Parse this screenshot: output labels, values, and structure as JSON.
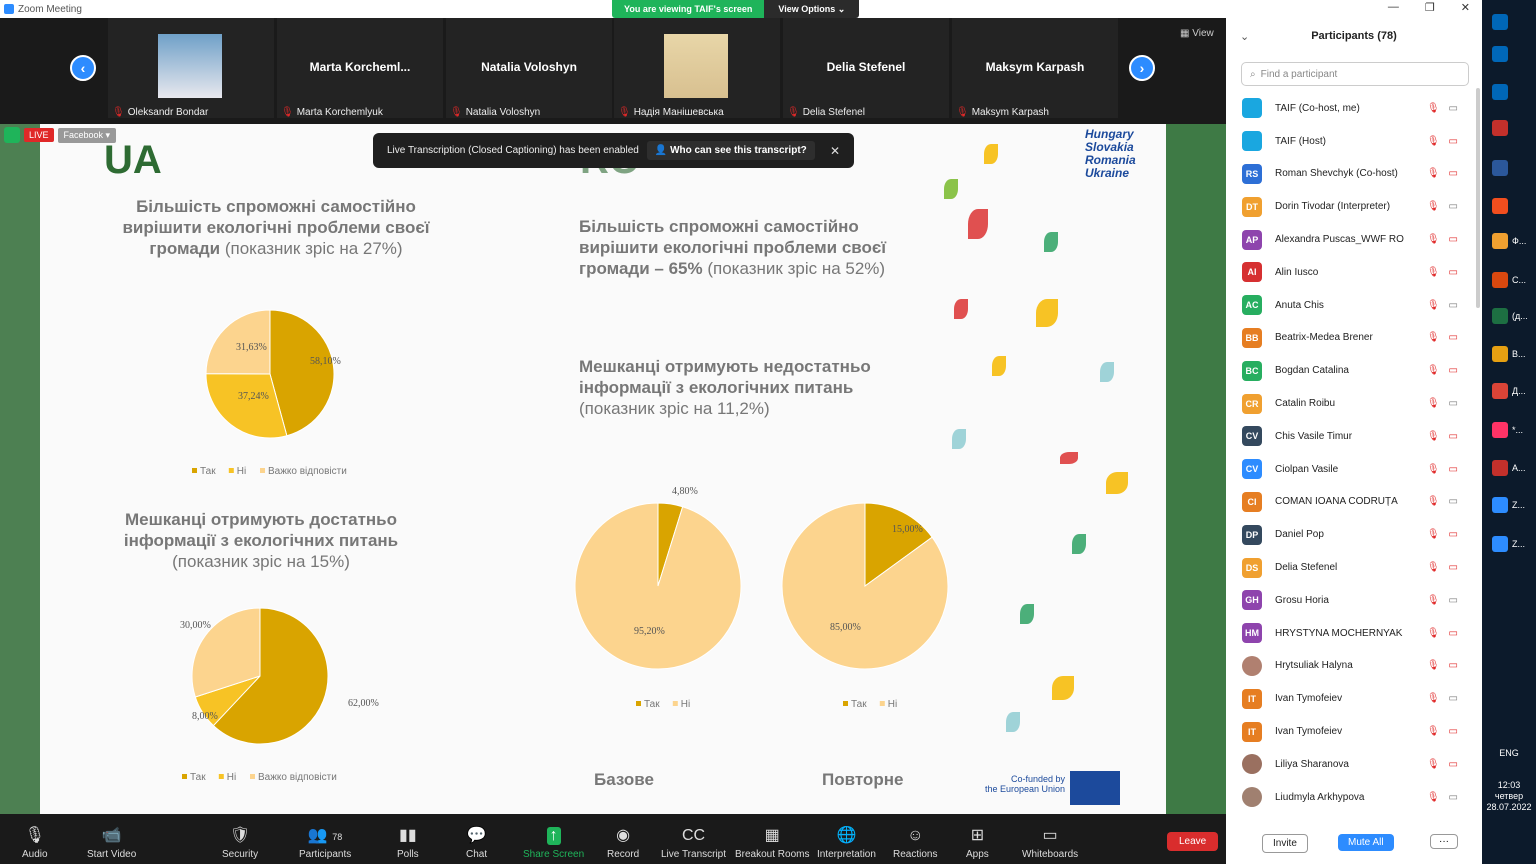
{
  "window": {
    "title": "Zoom Meeting"
  },
  "share_banner": {
    "viewing": "You are viewing TAIF's screen",
    "options": "View Options"
  },
  "strip": {
    "view_label": "View",
    "tiles": [
      {
        "name": "",
        "label": "Oleksandr Bondar",
        "has_photo": true
      },
      {
        "name": "Marta  Korcheml...",
        "label": "Marta Korchemlyuk"
      },
      {
        "name": "Natalia Voloshyn",
        "label": "Natalia Voloshyn"
      },
      {
        "name": "",
        "label": "Надія Манішевська",
        "has_photo": true
      },
      {
        "name": "Delia Stefenel",
        "label": "Delia Stefenel"
      },
      {
        "name": "Maksym Karpash",
        "label": "Maksym Karpash"
      }
    ]
  },
  "badges": {
    "live": "LIVE",
    "platform": "Facebook"
  },
  "transcription": {
    "text": "Live Transcription (Closed Captioning) has been enabled",
    "who": "Who can see this transcript?"
  },
  "slide": {
    "ua_heading": "UA",
    "ro_heading": "RO",
    "logo": [
      "Hungary",
      "Slovakia",
      "Romania",
      "Ukraine"
    ],
    "eu_text": [
      "Co-funded by",
      "the European Union"
    ],
    "ua_block1": {
      "bold": "Більшість спроможні самостійно вирішити екологічні проблеми своєї громади",
      "rest": "(показник зріс на 27%)"
    },
    "ua_block2": {
      "bold": "Мешканці отримують достатньо інформації з екологічних питань",
      "rest": "(показник зріс на 15%)"
    },
    "ro_block1": {
      "bold": "Більшість спроможні самостійно вирішити екологічні проблеми своєї громади – 65%",
      "rest": "(показник зріс на 52%)"
    },
    "ro_block2": {
      "bold": "Мешканці отримують недостатньо інформації з екологічних питань",
      "rest": "(показник зріс на 11,2%)"
    },
    "label_base": "Базове",
    "label_repeat": "Повторне",
    "colors": {
      "tak": "#d9a400",
      "ni": "#f7c325",
      "hard": "#fcd48e"
    }
  },
  "chart_data": [
    {
      "type": "pie",
      "categories": [
        "Так",
        "Ні",
        "Важко відповісти"
      ],
      "values": [
        58.1,
        37.24,
        31.63
      ],
      "labels": [
        "58,10%",
        "37,24%",
        "31,63%"
      ]
    },
    {
      "type": "pie",
      "categories": [
        "Так",
        "Ні",
        "Важко відповісти"
      ],
      "values": [
        62.0,
        8.0,
        30.0
      ],
      "labels": [
        "62,00%",
        "8,00%",
        "30,00%"
      ]
    },
    {
      "type": "pie",
      "categories": [
        "Так",
        "Ні"
      ],
      "values": [
        4.8,
        95.2
      ],
      "labels": [
        "4,80%",
        "95,20%"
      ]
    },
    {
      "type": "pie",
      "categories": [
        "Так",
        "Ні"
      ],
      "values": [
        15.0,
        85.0
      ],
      "labels": [
        "15,00%",
        "85,00%"
      ]
    }
  ],
  "toolbar": {
    "audio": "Audio",
    "start_video": "Start Video",
    "security": "Security",
    "participants": "Participants",
    "participants_count": "78",
    "polls": "Polls",
    "chat": "Chat",
    "share_screen": "Share Screen",
    "record": "Record",
    "live_transcript": "Live Transcript",
    "breakout": "Breakout Rooms",
    "interpretation": "Interpretation",
    "reactions": "Reactions",
    "apps": "Apps",
    "whiteboards": "Whiteboards",
    "leave": "Leave"
  },
  "panel": {
    "title": "Participants (78)",
    "search_placeholder": "Find a participant",
    "invite": "Invite",
    "mute_all": "Mute All",
    "more": "···",
    "participants": [
      {
        "initials": "",
        "name": "TAIF (Co-host, me)",
        "color": "#1aa7e0"
      },
      {
        "initials": "",
        "name": "TAIF (Host)",
        "color": "#1aa7e0"
      },
      {
        "initials": "RS",
        "name": "Roman Shevchyk (Co-host)",
        "color": "#2d6fd6"
      },
      {
        "initials": "DT",
        "name": "Dorin Tivodar (Interpreter)",
        "color": "#f0a030"
      },
      {
        "initials": "AP",
        "name": "Alexandra Puscas_WWF RO",
        "color": "#8e44ad"
      },
      {
        "initials": "AI",
        "name": "Alin Iusco",
        "color": "#d63031"
      },
      {
        "initials": "AC",
        "name": "Anuta Chis",
        "color": "#27ae60"
      },
      {
        "initials": "BB",
        "name": "Beatrix-Medea Brener",
        "color": "#e67e22"
      },
      {
        "initials": "BC",
        "name": "Bogdan Catalina",
        "color": "#27ae60"
      },
      {
        "initials": "CR",
        "name": "Catalin Roibu",
        "color": "#f0a030"
      },
      {
        "initials": "CV",
        "name": "Chis Vasile Timur",
        "color": "#34495e"
      },
      {
        "initials": "CV",
        "name": "Ciolpan Vasile",
        "color": "#2d8cff"
      },
      {
        "initials": "CI",
        "name": "COMAN IOANA CODRUȚA",
        "color": "#e67e22"
      },
      {
        "initials": "DP",
        "name": "Daniel Pop",
        "color": "#34495e"
      },
      {
        "initials": "DS",
        "name": "Delia Stefenel",
        "color": "#f0a030"
      },
      {
        "initials": "GH",
        "name": "Grosu Horia",
        "color": "#8e44ad"
      },
      {
        "initials": "HM",
        "name": "HRYSTYNA MOCHERNYAK",
        "color": "#8e44ad"
      },
      {
        "initials": "",
        "name": "Hrytsuliak Halyna",
        "color": "#b08070"
      },
      {
        "initials": "IT",
        "name": "Ivan Tymofeiev",
        "color": "#e67e22"
      },
      {
        "initials": "IT",
        "name": "Ivan Tymofeiev",
        "color": "#e67e22"
      },
      {
        "initials": "",
        "name": "Liliya Sharanova",
        "color": "#9a7060"
      },
      {
        "initials": "",
        "name": "Liudmyla Arkhypova",
        "color": "#a08070"
      }
    ]
  },
  "taskbar": {
    "lang": "ENG",
    "time": "12:03",
    "day": "четвер",
    "date": "28.07.2022",
    "apps": [
      "Ф...",
      "С...",
      "(д...",
      "В...",
      "Д...",
      "*...",
      "А...",
      "Z...",
      "Z..."
    ]
  }
}
